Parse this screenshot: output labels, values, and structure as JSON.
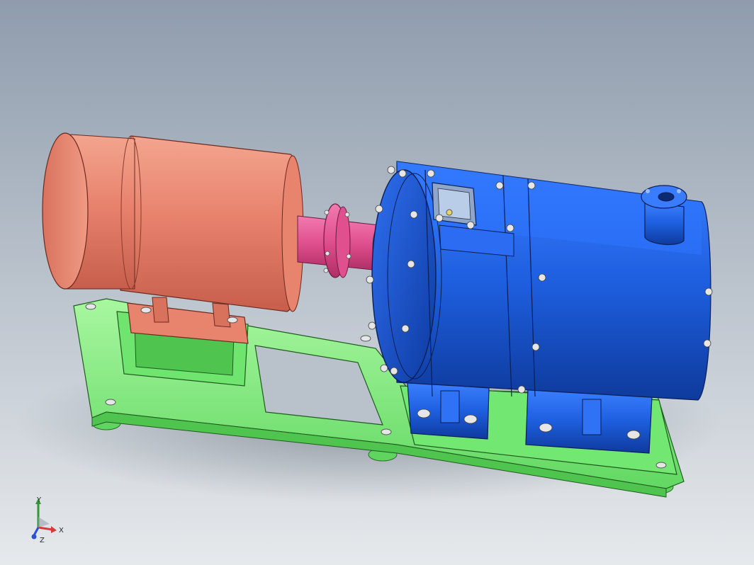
{
  "viewport": {
    "background_top": "#8f9cad",
    "background_bottom": "#e6e9ec"
  },
  "assembly": {
    "motor_color": "#e8836e",
    "coupling_color": "#e0508e",
    "pump_color": "#1e5fe0",
    "base_frame_color": "#7cef7c",
    "bolt_color": "#d8d8d8"
  },
  "triad": {
    "x_label": "X",
    "y_label": "Y",
    "z_label": "Z",
    "x_color": "#d83a3a",
    "y_color": "#2f9a2f",
    "z_color": "#2a4fd8"
  }
}
